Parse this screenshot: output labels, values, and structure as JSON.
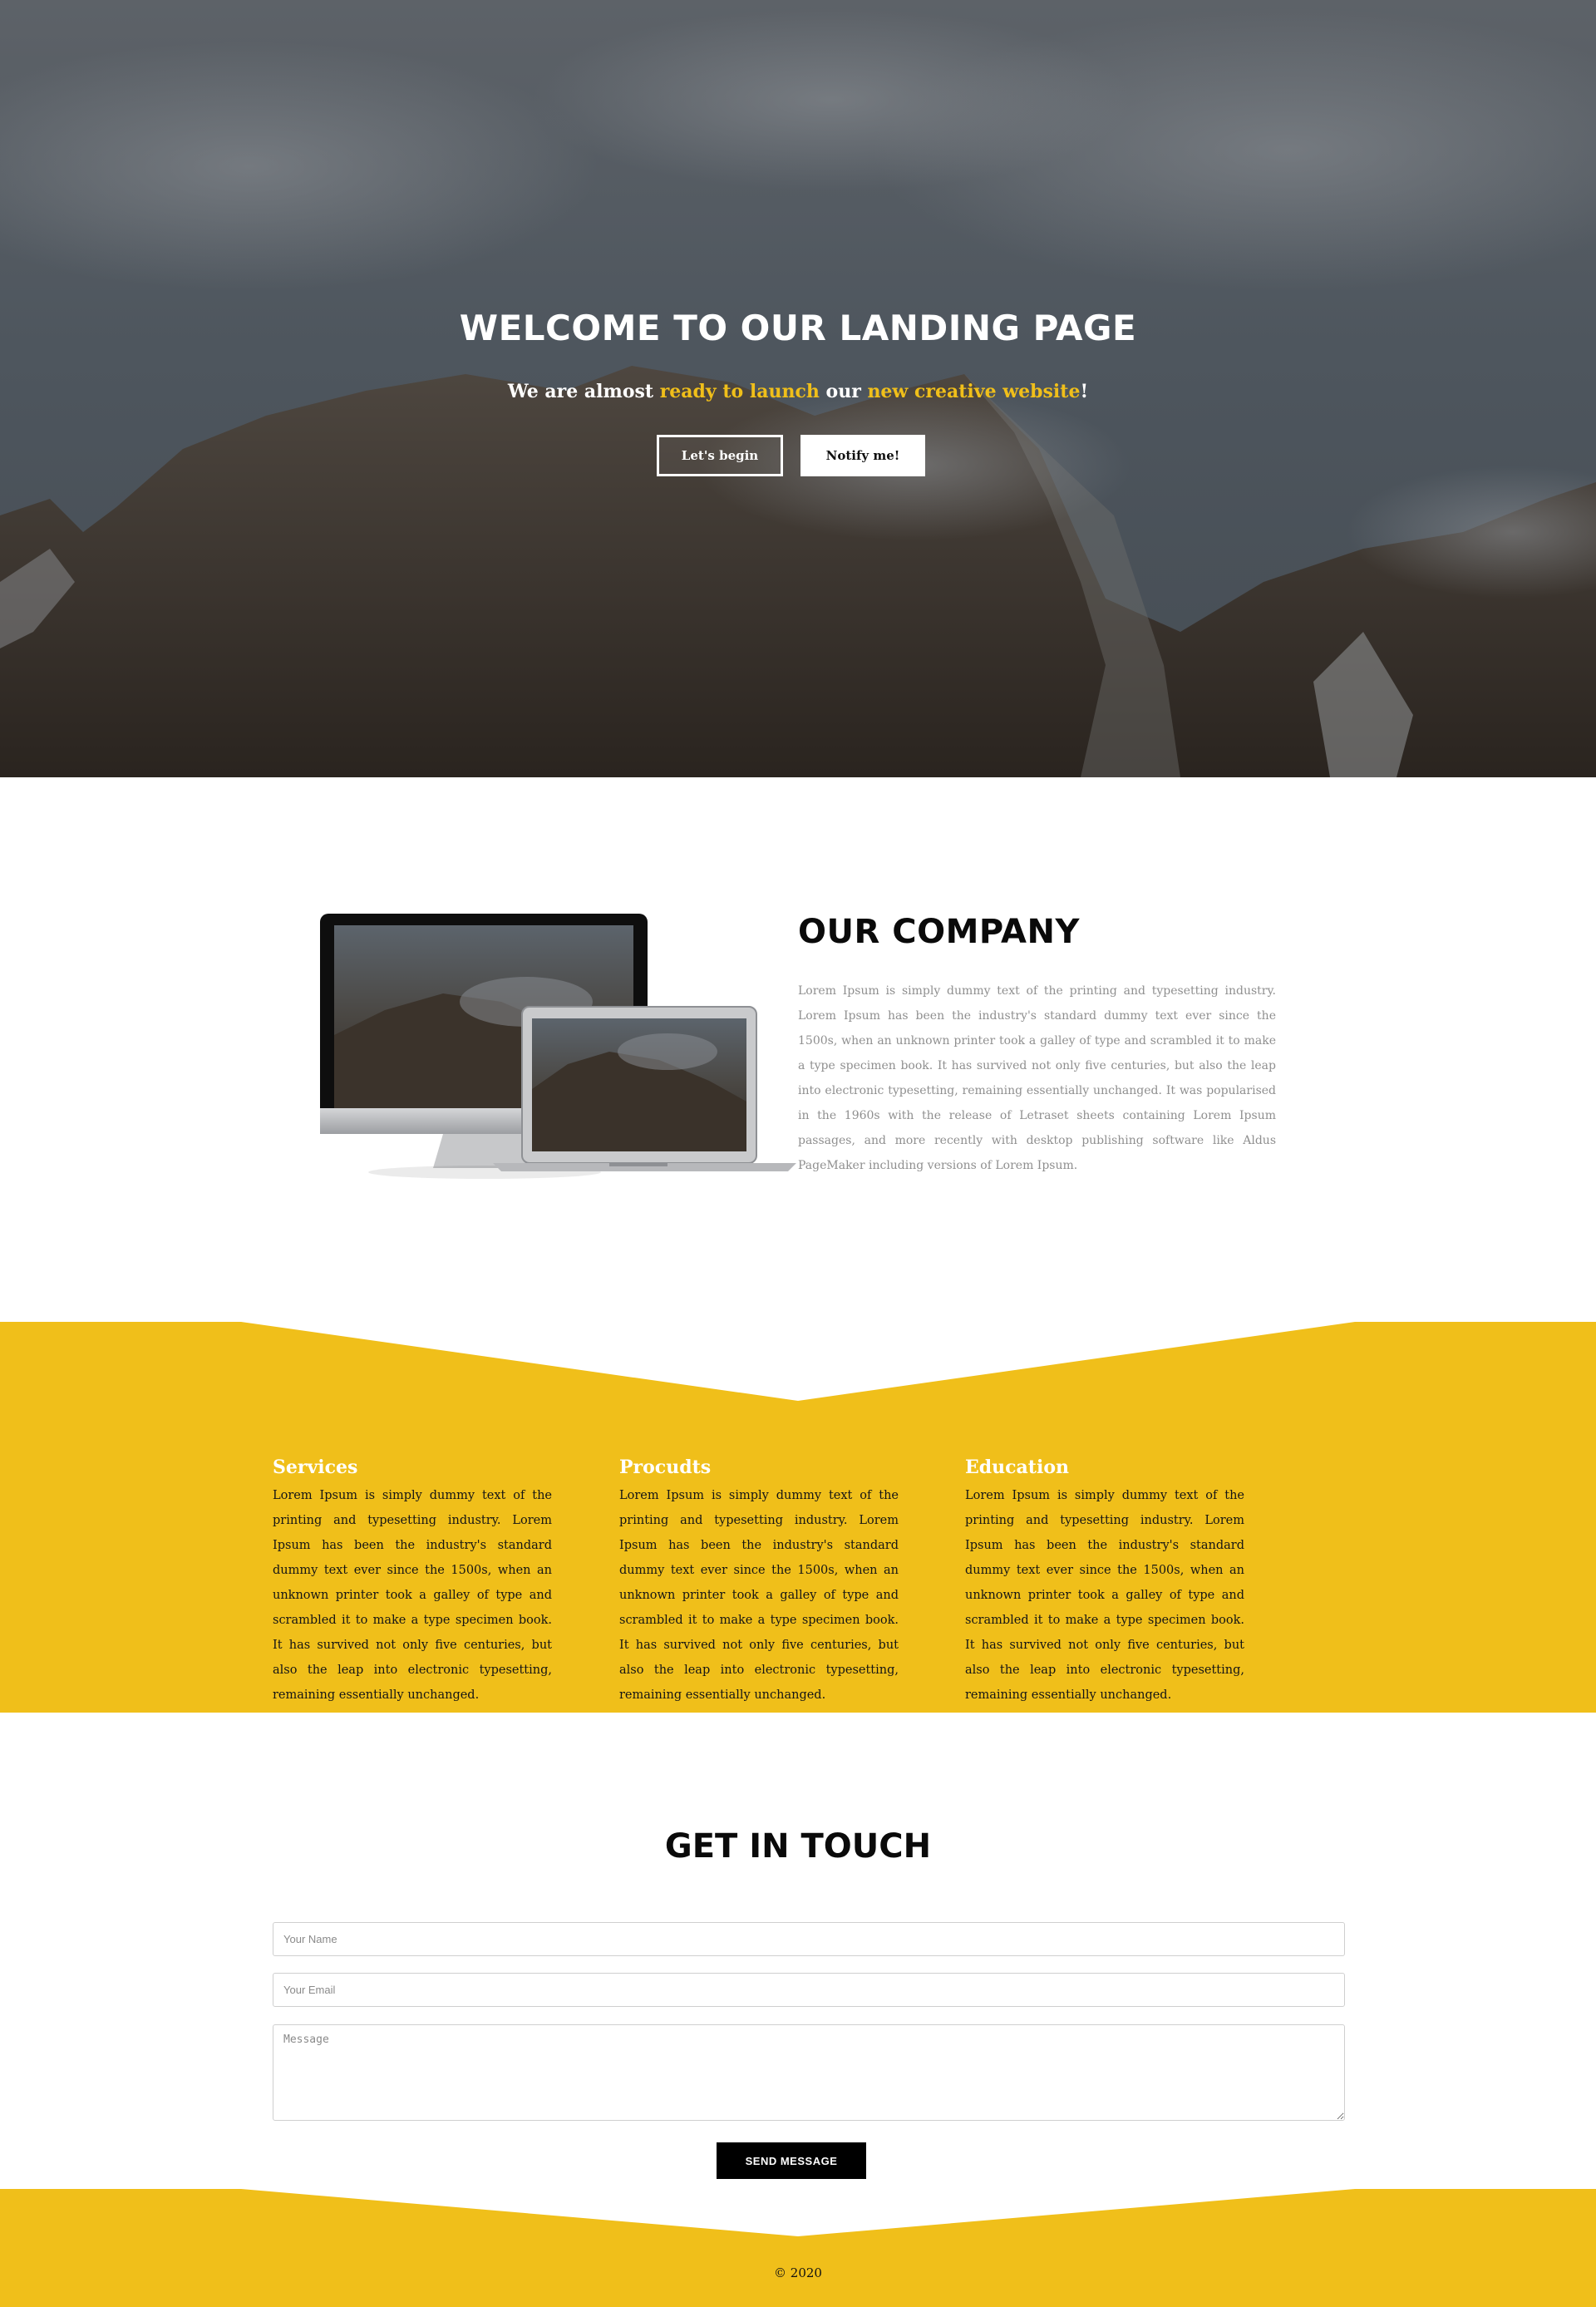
{
  "hero": {
    "title": "WELCOME TO OUR LANDING PAGE",
    "subtitle_part1": "We are almost ",
    "subtitle_highlight1": "ready to launch",
    "subtitle_part2": " our ",
    "subtitle_highlight2": "new creative website",
    "subtitle_part3": "!",
    "begin_label": "Let's begin",
    "notify_label": "Notify me!"
  },
  "company": {
    "title": "OUR COMPANY",
    "text": "Lorem Ipsum is simply dummy text of the printing and typesetting industry. Lorem Ipsum has been the industry's standard dummy text ever since the 1500s, when an unknown printer took a galley of type and scrambled it to make a type specimen book. It has survived not only five centuries, but also the leap into electronic typesetting, remaining essentially unchanged. It was popularised in the 1960s with the release of Letraset sheets containing Lorem Ipsum passages, and more recently with desktop publishing software like Aldus PageMaker including versions of Lorem Ipsum."
  },
  "services": [
    {
      "title": "Services",
      "text": "Lorem Ipsum is simply dummy text of the printing and typesetting industry. Lorem Ipsum has been the industry's standard dummy text ever since the 1500s, when an unknown printer took a galley of type and scrambled it to make a type specimen book. It has survived not only five centuries, but also the leap into electronic typesetting, remaining essentially unchanged."
    },
    {
      "title": "Procudts",
      "text": "Lorem Ipsum is simply dummy text of the printing and typesetting industry. Lorem Ipsum has been the industry's standard dummy text ever since the 1500s, when an unknown printer took a galley of type and scrambled it to make a type specimen book. It has survived not only five centuries, but also the leap into electronic typesetting, remaining essentially unchanged."
    },
    {
      "title": "Education",
      "text": "Lorem Ipsum is simply dummy text of the printing and typesetting industry. Lorem Ipsum has been the industry's standard dummy text ever since the 1500s, when an unknown printer took a galley of type and scrambled it to make a type specimen book. It has survived not only five centuries, but also the leap into electronic typesetting, remaining essentially unchanged."
    }
  ],
  "contact": {
    "title": "GET IN TOUCH",
    "name_placeholder": "Your Name",
    "email_placeholder": "Your Email",
    "message_placeholder": "Message",
    "send_label": "SEND MESSAGE"
  },
  "footer": {
    "copyright": "© 2020"
  },
  "colors": {
    "accent": "#f0bf1a",
    "dark": "#0a0a0a"
  }
}
